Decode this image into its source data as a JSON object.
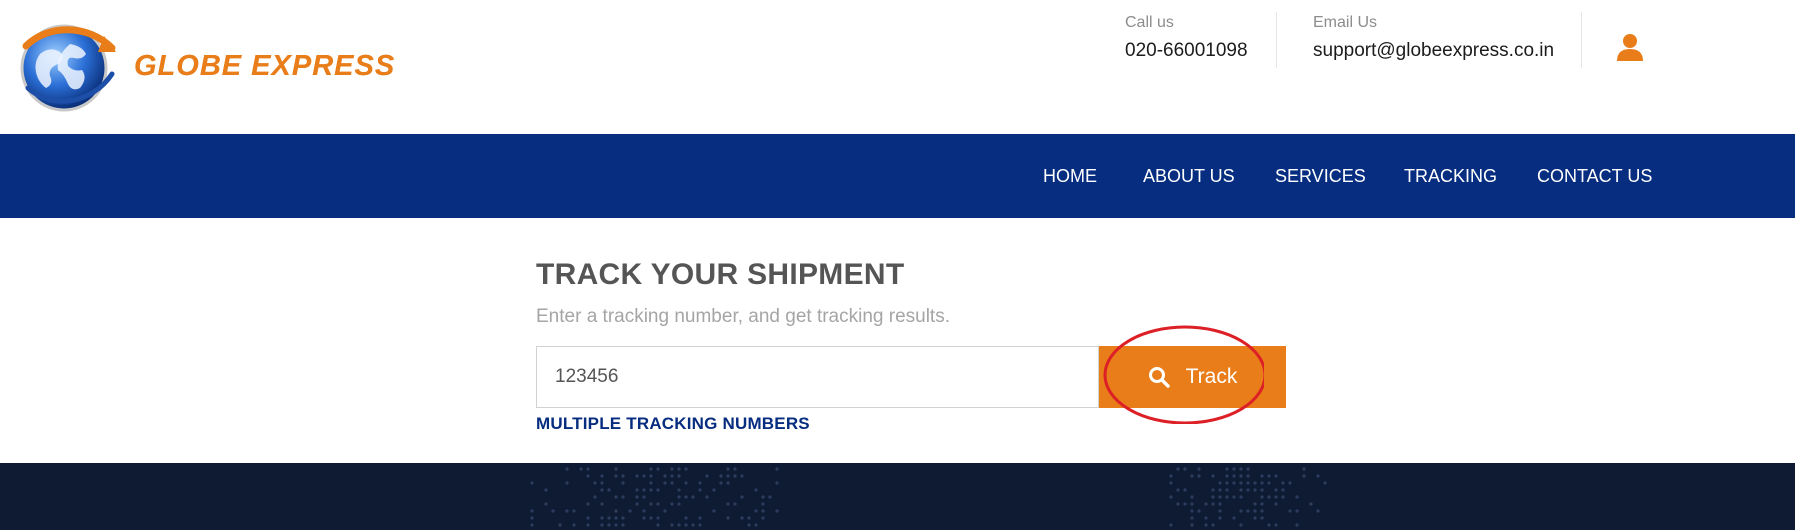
{
  "brand": {
    "name": "GLOBE EXPRESS",
    "color": "#e87d1a"
  },
  "contact": {
    "call_label": "Call us",
    "call_value": "020-66001098",
    "email_label": "Email Us",
    "email_value": "support@globeexpress.co.in"
  },
  "nav": {
    "items": [
      {
        "label": "HOME"
      },
      {
        "label": "ABOUT US"
      },
      {
        "label": "SERVICES"
      },
      {
        "label": "TRACKING"
      },
      {
        "label": "CONTACT US"
      }
    ],
    "background": "#062d7f"
  },
  "tracking": {
    "title": "TRACK YOUR SHIPMENT",
    "subtitle": "Enter a tracking number, and get tracking results.",
    "input_value": "123456",
    "button_label": "Track",
    "multiple_link": "MULTIPLE TRACKING NUMBERS"
  },
  "icons": {
    "user": "user-icon",
    "search": "search-icon",
    "logo": "globe-logo-icon"
  },
  "colors": {
    "accent": "#e87d1a",
    "footer": "#0f1b33",
    "highlight": "#dd1f26"
  }
}
